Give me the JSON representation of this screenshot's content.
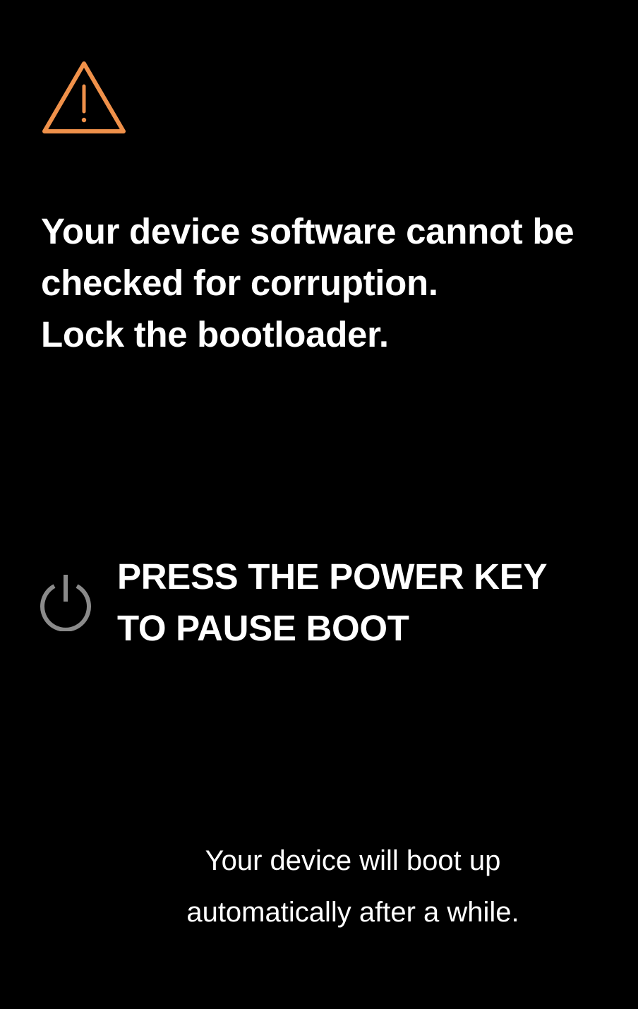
{
  "warning": {
    "icon": "warning-triangle-icon",
    "color": "#F0914A"
  },
  "message": {
    "lines": [
      "Your device software cannot be",
      "checked for corruption.",
      "Lock the bootloader."
    ]
  },
  "power": {
    "icon": "power-icon",
    "icon_color": "#8A8A8A",
    "lines": [
      "PRESS THE POWER KEY",
      "TO PAUSE BOOT"
    ]
  },
  "footer": {
    "lines": [
      "Your device will boot up",
      "automatically after a while."
    ]
  },
  "colors": {
    "background": "#000000",
    "text": "#FFFFFF"
  }
}
